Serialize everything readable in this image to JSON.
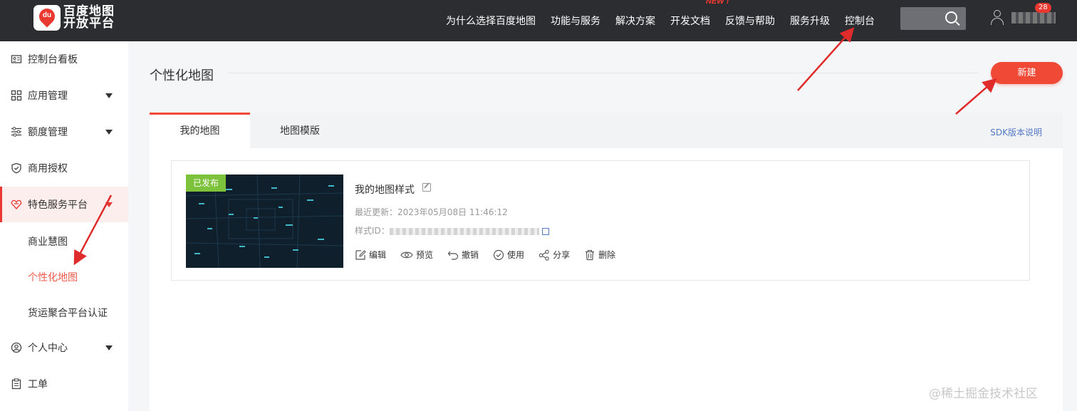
{
  "brand": {
    "logo_mark": "du",
    "line1": "百度地图",
    "line2": "开放平台"
  },
  "nav": {
    "items": [
      "为什么选择百度地图",
      "功能与服务",
      "解决方案",
      "开发文档",
      "反馈与帮助",
      "服务升级",
      "控制台"
    ],
    "new_tag": "NEW !",
    "badge_count": "28"
  },
  "sidebar": {
    "items": [
      {
        "label": "控制台看板",
        "icon": "dashboard-icon"
      },
      {
        "label": "应用管理",
        "icon": "grid-icon"
      },
      {
        "label": "额度管理",
        "icon": "sliders-icon"
      },
      {
        "label": "商用授权",
        "icon": "shield-icon"
      },
      {
        "label": "特色服务平台",
        "icon": "heart-icon"
      },
      {
        "label": "个人中心",
        "icon": "user-circle-icon"
      },
      {
        "label": "工单",
        "icon": "clipboard-icon"
      }
    ],
    "sub_items": [
      "商业慧图",
      "个性化地图",
      "货运聚合平台认证"
    ],
    "current_sub": "个性化地图"
  },
  "main": {
    "title": "个性化地图",
    "new_button": "新建",
    "tabs": [
      "我的地图",
      "地图模版"
    ],
    "sdk_link": "SDK版本说明"
  },
  "card": {
    "status": "已发布",
    "title": "我的地图样式",
    "updated": "最近更新：2023年05月08日 11:46:12",
    "style_id_label": "样式ID：",
    "actions": [
      "编辑",
      "预览",
      "撤销",
      "使用",
      "分享",
      "删除"
    ]
  },
  "watermark": "@稀土掘金技术社区",
  "colors": {
    "accent": "#f04a37",
    "topbar": "#2b2d31",
    "published": "#7cc23b",
    "link": "#5479c4"
  }
}
